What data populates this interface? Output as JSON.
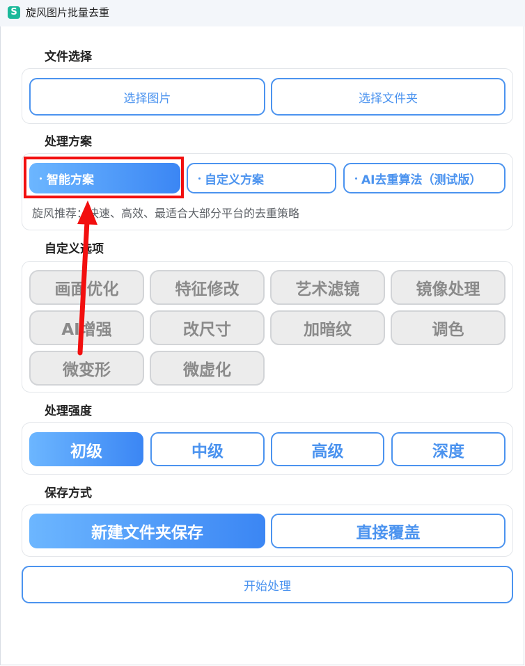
{
  "window": {
    "title": "旋风图片批量去重",
    "icon_glyph": "S",
    "icon_color": "#1bb99a"
  },
  "file_select": {
    "title": "文件选择",
    "select_images": "选择图片",
    "select_folder": "选择文件夹"
  },
  "scheme": {
    "title": "处理方案",
    "options": [
      "智能方案",
      "自定义方案",
      "AI去重算法（测试版）"
    ],
    "selected": "智能方案",
    "description": "旋风推荐：快速、高效、最适合大部分平台的去重策略"
  },
  "custom": {
    "title": "自定义选项",
    "options": [
      "画面优化",
      "特征修改",
      "艺术滤镜",
      "镜像处理",
      "AI增强",
      "改尺寸",
      "加暗纹",
      "调色",
      "微变形",
      "微虚化"
    ],
    "state": "disabled"
  },
  "strength": {
    "title": "处理强度",
    "levels": [
      "初级",
      "中级",
      "高级",
      "深度"
    ],
    "selected": "初级"
  },
  "save": {
    "title": "保存方式",
    "new_folder": "新建文件夹保存",
    "overwrite": "直接覆盖",
    "selected": "新建文件夹保存"
  },
  "start_button": "开始处理",
  "colors": {
    "accent": "#4b93ef",
    "accent_gradient_start": "#6cb6ff",
    "accent_gradient_end": "#3b86f4",
    "disabled_bg": "#ececec",
    "annotation_red": "#f20f0f"
  }
}
